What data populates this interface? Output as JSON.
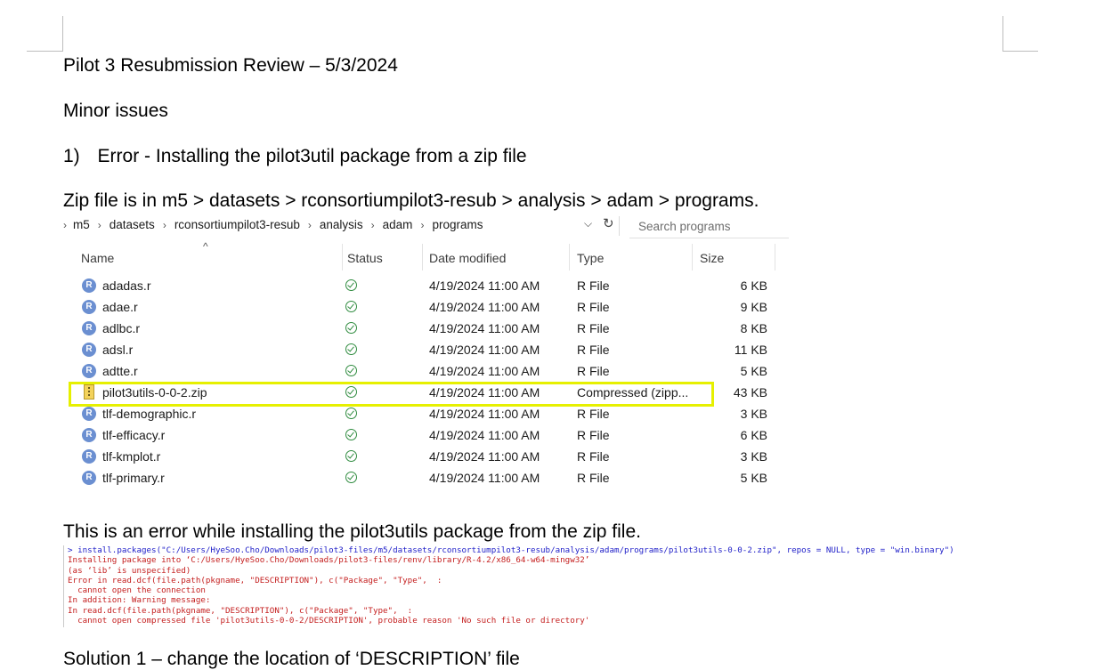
{
  "document": {
    "title": "Pilot 3 Resubmission Review – 5/3/2024",
    "section_heading": "Minor issues",
    "item_number": "1)",
    "item_title": "Error - Installing the pilot3util package from a zip file",
    "location_text": "Zip file is in m5 > datasets > rconsortiumpilot3-resub > analysis > adam > programs.",
    "error_intro": "This is an error while installing the pilot3utils package from the zip file.",
    "solution_heading": "Solution 1 – change the location of ‘DESCRIPTION’ file"
  },
  "explorer": {
    "breadcrumb": [
      "m5",
      "datasets",
      "rconsortiumpilot3-resub",
      "analysis",
      "adam",
      "programs"
    ],
    "search_placeholder": "Search programs",
    "columns": {
      "name": "Name",
      "status": "Status",
      "date": "Date modified",
      "type": "Type",
      "size": "Size"
    },
    "files": [
      {
        "name": "adadas.r",
        "icon": "r-file-icon",
        "date": "4/19/2024 11:00 AM",
        "type": "R File",
        "size": "6 KB"
      },
      {
        "name": "adae.r",
        "icon": "r-file-icon",
        "date": "4/19/2024 11:00 AM",
        "type": "R File",
        "size": "9 KB"
      },
      {
        "name": "adlbc.r",
        "icon": "r-file-icon",
        "date": "4/19/2024 11:00 AM",
        "type": "R File",
        "size": "8 KB"
      },
      {
        "name": "adsl.r",
        "icon": "r-file-icon",
        "date": "4/19/2024 11:00 AM",
        "type": "R File",
        "size": "11 KB"
      },
      {
        "name": "adtte.r",
        "icon": "r-file-icon",
        "date": "4/19/2024 11:00 AM",
        "type": "R File",
        "size": "5 KB"
      },
      {
        "name": "pilot3utils-0-0-2.zip",
        "icon": "zip-file-icon",
        "date": "4/19/2024 11:00 AM",
        "type": "Compressed (zipp...",
        "size": "43 KB",
        "highlighted": true
      },
      {
        "name": "tlf-demographic.r",
        "icon": "r-file-icon",
        "date": "4/19/2024 11:00 AM",
        "type": "R File",
        "size": "3 KB"
      },
      {
        "name": "tlf-efficacy.r",
        "icon": "r-file-icon",
        "date": "4/19/2024 11:00 AM",
        "type": "R File",
        "size": "6 KB"
      },
      {
        "name": "tlf-kmplot.r",
        "icon": "r-file-icon",
        "date": "4/19/2024 11:00 AM",
        "type": "R File",
        "size": "3 KB"
      },
      {
        "name": "tlf-primary.r",
        "icon": "r-file-icon",
        "date": "4/19/2024 11:00 AM",
        "type": "R File",
        "size": "5 KB"
      }
    ]
  },
  "console": {
    "lines": [
      {
        "kind": "cmd",
        "text": "> install.packages(\"C:/Users/HyeSoo.Cho/Downloads/pilot3-files/m5/datasets/rconsortiumpilot3-resub/analysis/adam/programs/pilot3utils-0-0-2.zip\", repos = NULL, type = \"win.binary\")"
      },
      {
        "kind": "err",
        "text": "Installing package into ‘C:/Users/HyeSoo.Cho/Downloads/pilot3-files/renv/library/R-4.2/x86_64-w64-mingw32’"
      },
      {
        "kind": "err",
        "text": "(as ‘lib’ is unspecified)"
      },
      {
        "kind": "err",
        "text": "Error in read.dcf(file.path(pkgname, \"DESCRIPTION\"), c(\"Package\", \"Type\",  :"
      },
      {
        "kind": "err",
        "text": "  cannot open the connection"
      },
      {
        "kind": "err",
        "text": "In addition: Warning message:"
      },
      {
        "kind": "err",
        "text": "In read.dcf(file.path(pkgname, \"DESCRIPTION\"), c(\"Package\", \"Type\",  :"
      },
      {
        "kind": "err",
        "text": "  cannot open compressed file 'pilot3utils-0-0-2/DESCRIPTION', probable reason 'No such file or directory'"
      }
    ]
  },
  "colors": {
    "highlight": "#e6f000",
    "cmd_text": "#1e1ec8",
    "error_text": "#c41e1e",
    "status_ok": "#2e8b3e",
    "r_icon": "#6b8fd1"
  }
}
